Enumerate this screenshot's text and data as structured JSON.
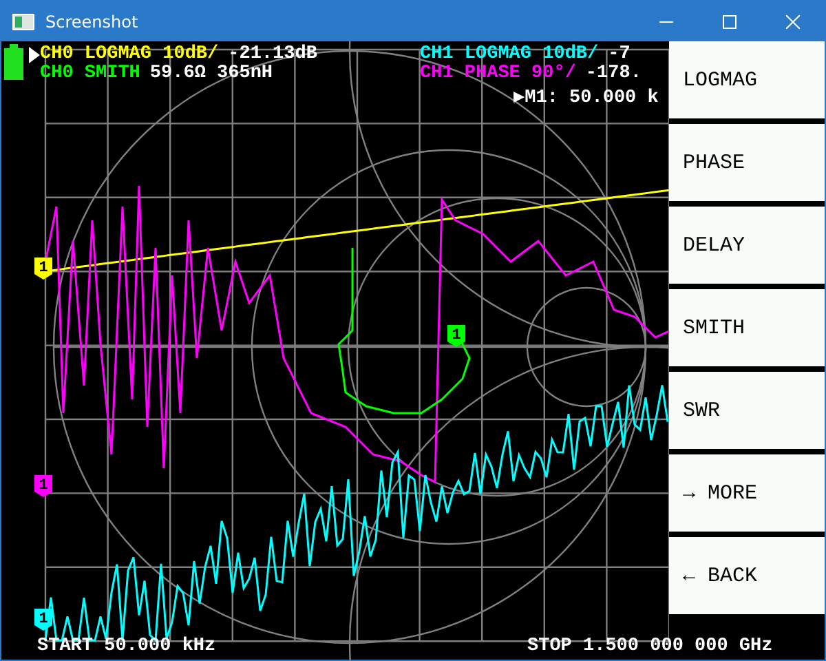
{
  "window": {
    "title": "Screenshot"
  },
  "channels": [
    {
      "label": "CH0 LOGMAG 10dB/",
      "value": "-21.13dB",
      "color": "#ffff00",
      "selected": true
    },
    {
      "label": "CH0 SMITH",
      "value": "59.6Ω 365nH",
      "color": "#00ff00",
      "selected": false
    },
    {
      "label": "CH1 LOGMAG 10dB/",
      "value": "-7",
      "color": "#00ffff",
      "selected": false
    },
    {
      "label": "CH1 PHASE 90°/",
      "value": "-178.",
      "color": "#ff00ff",
      "selected": false
    }
  ],
  "marker_readout": "▶M1: 50.000 k",
  "markers": [
    {
      "label": "1",
      "color": "#ffff00"
    },
    {
      "label": "1",
      "color": "#ff00ff"
    },
    {
      "label": "1",
      "color": "#00ffff"
    },
    {
      "label": "1",
      "color": "#00ff00"
    }
  ],
  "start": "START 50.000 kHz",
  "stop": "STOP 1.500 000 000 GHz",
  "menu": [
    "LOGMAG",
    "PHASE",
    "DELAY",
    "SMITH",
    "SWR",
    "→ MORE",
    "← BACK"
  ]
}
